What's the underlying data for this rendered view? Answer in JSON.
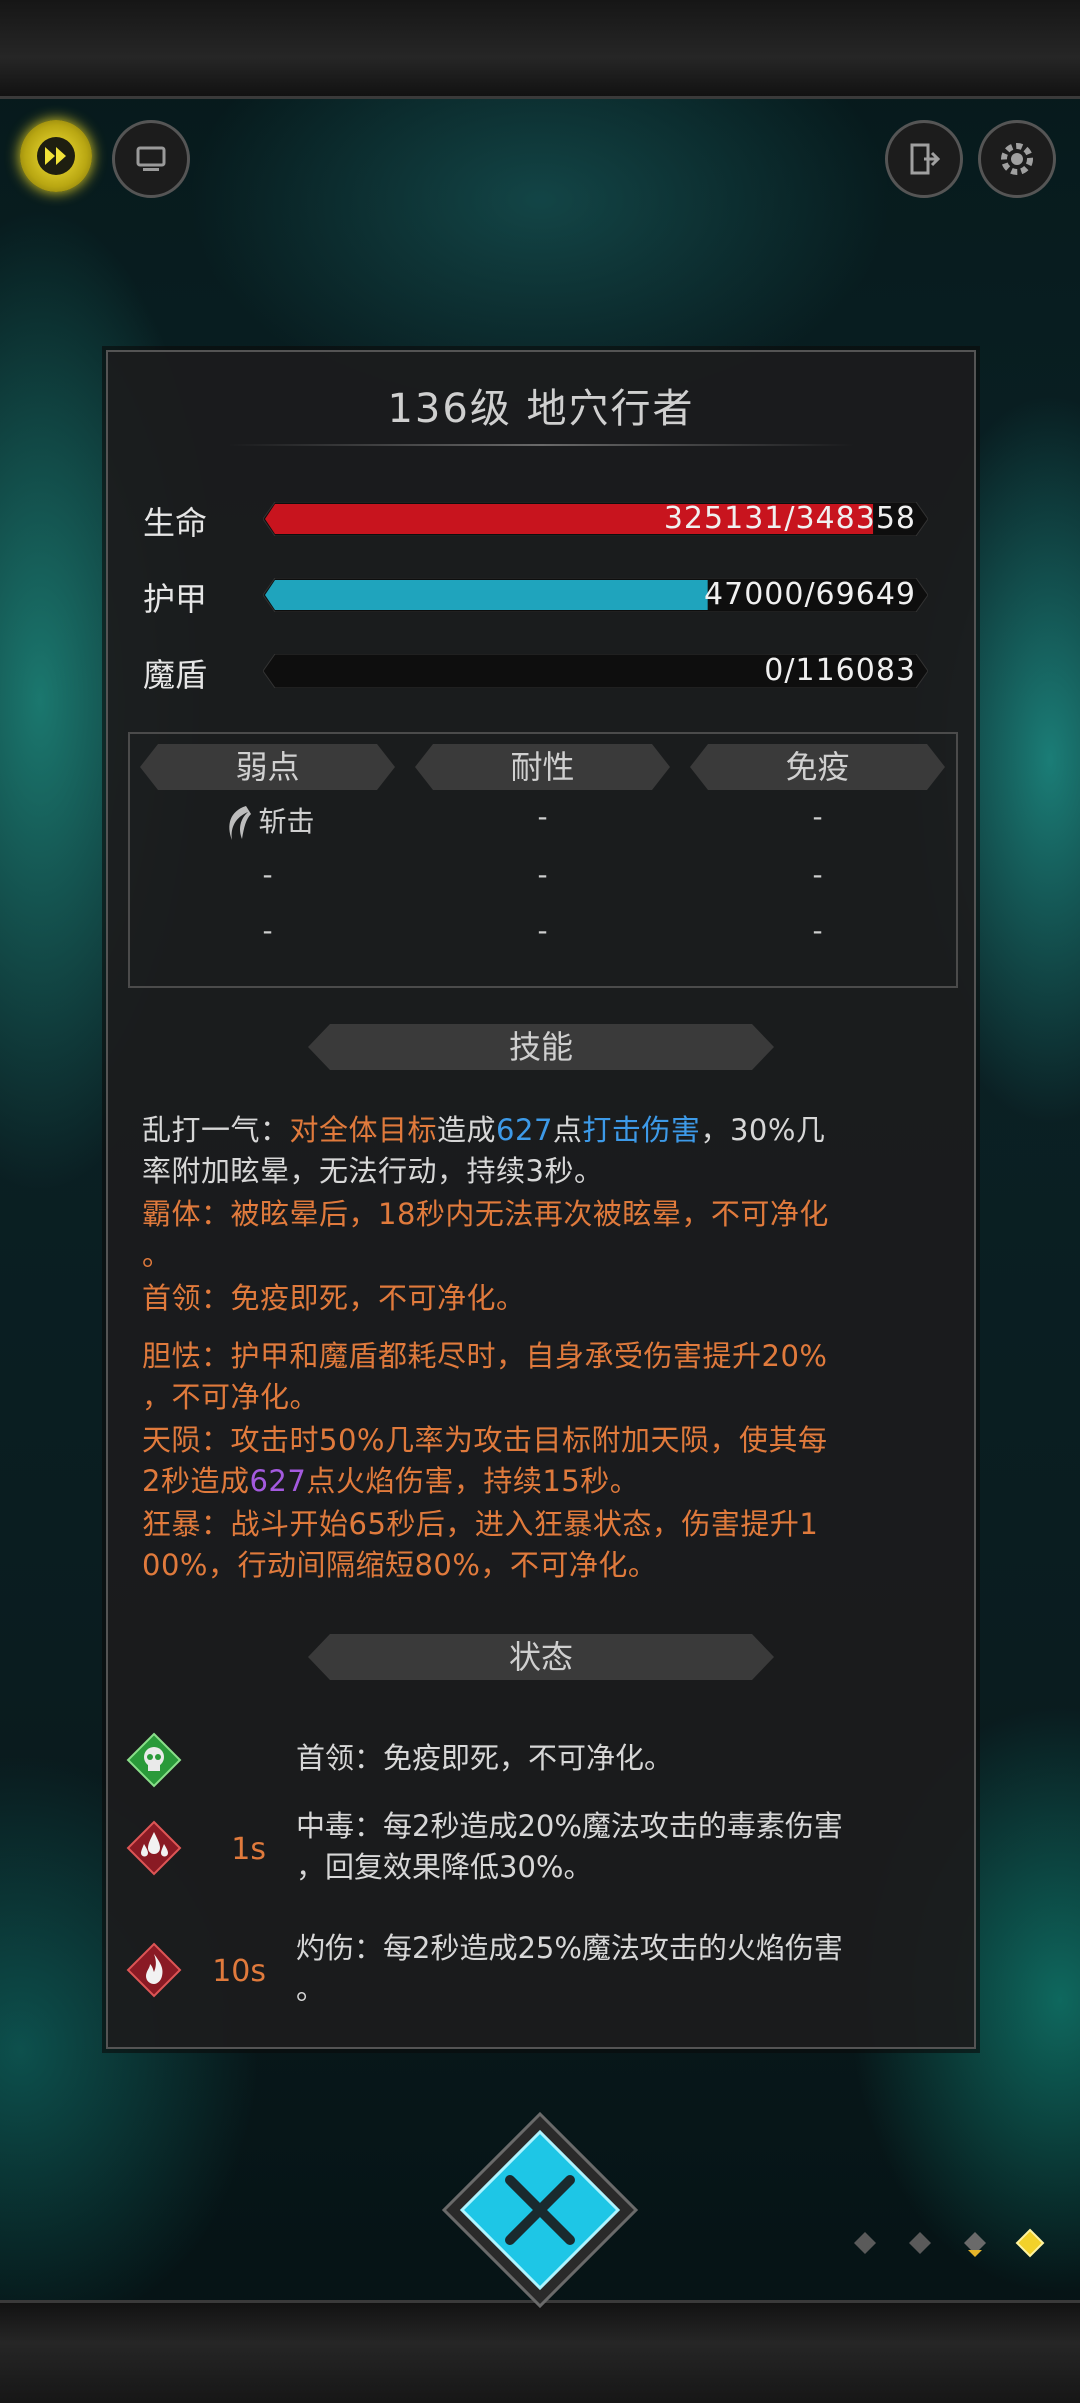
{
  "header": {
    "title": "136级  地穴行者"
  },
  "stats": [
    {
      "key": "hp",
      "label": "生命",
      "value": "325131/348358",
      "fraction": 0.933,
      "color": "#c8141e"
    },
    {
      "key": "armor",
      "label": "护甲",
      "value": "47000/69649",
      "fraction": 0.675,
      "color": "#1fa4bd"
    },
    {
      "key": "shield",
      "label": "魔盾",
      "value": "0/116083",
      "fraction": 0.0,
      "color": "#6b6bd8"
    }
  ],
  "resist": {
    "headers": [
      "弱点",
      "耐性",
      "免疫"
    ],
    "rows": [
      [
        "斩击",
        "-",
        "-"
      ],
      [
        "-",
        "-",
        "-"
      ],
      [
        "-",
        "-",
        "-"
      ]
    ]
  },
  "skills_title": "技能",
  "skills": {
    "s1_name": "乱打一气：",
    "s1_a": "对全体目标",
    "s1_b": "造成",
    "s1_c": "627",
    "s1_d": "点",
    "s1_e": "打击伤害",
    "s1_f": "，30%几",
    "s1_g": "率附加眩晕，无法行动，持续3秒。",
    "s2_l1": "霸体：被眩晕后，18秒内无法再次被眩晕，不可净化",
    "s2_l2": "。",
    "s3_l1": "首领：免疫即死，不可净化。",
    "s4_l1": "胆怯：护甲和魔盾都耗尽时，自身承受伤害提升20%",
    "s4_l2": "，不可净化。",
    "s5_l1": "天陨：攻击时50%几率为攻击目标附加天陨，使其每",
    "s5_a": "2秒造成",
    "s5_b": "627",
    "s5_c": "点火焰伤害，持续15秒。",
    "s6_l1": "狂暴：战斗开始65秒后，进入狂暴状态，伤害提升1",
    "s6_l2": "00%，行动间隔缩短80%，不可净化。"
  },
  "status_title": "状态",
  "statuses": [
    {
      "icon": "skull-icon",
      "duration": "",
      "line1": "首领：免疫即死，不可净化。",
      "line2": ""
    },
    {
      "icon": "poison-drops-icon",
      "duration": "1s",
      "line1": "中毒：每2秒造成20%魔法攻击的毒素伤害",
      "line2": "，回复效果降低30%。"
    },
    {
      "icon": "flame-icon",
      "duration": "10s",
      "line1": "灼伤：每2秒造成25%魔法攻击的火焰伤害",
      "line2": "。"
    }
  ],
  "colors": {
    "accent_orange": "#e07a3c",
    "accent_blue": "#3d9ae8",
    "accent_purple": "#a45adf",
    "close_cyan": "#1ec6e6"
  }
}
